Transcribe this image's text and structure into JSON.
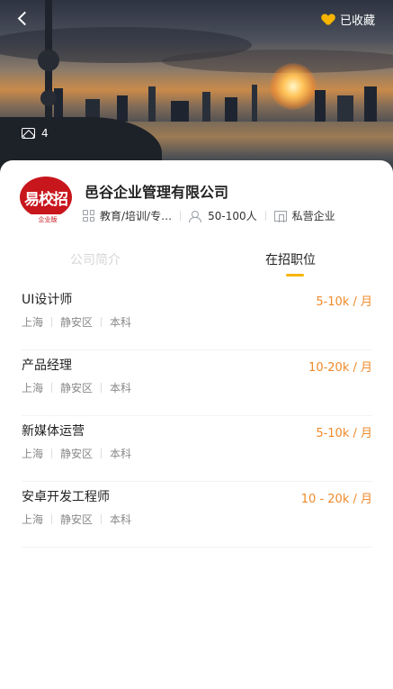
{
  "header": {
    "favorite_label": "已收藏",
    "photo_count": "4",
    "favorite_color": "#f7b500"
  },
  "company": {
    "logo_text": "易校招",
    "logo_subtext": "企业版",
    "name": "邑谷企业管理有限公司",
    "industry": "教育/培训/专…",
    "size": "50-100人",
    "type": "私营企业",
    "brand_color": "#c8161d"
  },
  "tabs": [
    {
      "label": "公司简介",
      "active": false
    },
    {
      "label": "在招职位",
      "active": true
    }
  ],
  "jobs": [
    {
      "title": "UI设计师",
      "salary": "5-10k / 月",
      "city": "上海",
      "district": "静安区",
      "education": "本科"
    },
    {
      "title": "产品经理",
      "salary": "10-20k / 月",
      "city": "上海",
      "district": "静安区",
      "education": "本科"
    },
    {
      "title": "新媒体运营",
      "salary": "5-10k / 月",
      "city": "上海",
      "district": "静安区",
      "education": "本科"
    },
    {
      "title": "安卓开发工程师",
      "salary": "10 - 20k / 月",
      "city": "上海",
      "district": "静安区",
      "education": "本科"
    }
  ],
  "colors": {
    "accent": "#f7b500",
    "salary": "#f08a2a"
  },
  "icons": [
    "back-arrow-icon",
    "heart-icon",
    "image-icon",
    "industry-grid-icon",
    "people-icon",
    "building-icon"
  ]
}
